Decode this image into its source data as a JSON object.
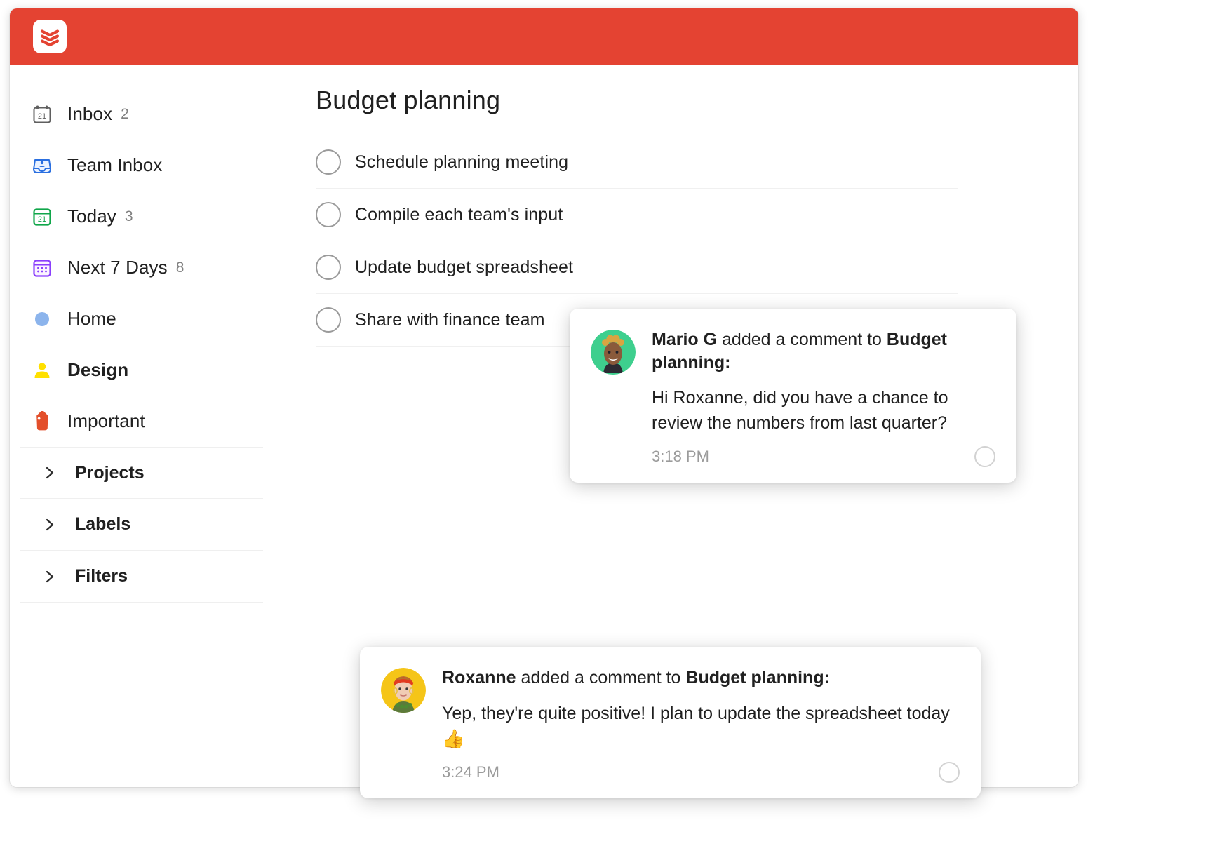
{
  "app": {
    "brand_color": "#e44332",
    "logo_icon": "todoist-logo-icon"
  },
  "sidebar": {
    "items": [
      {
        "label": "Inbox",
        "count": "2",
        "icon": "calendar-gray-icon",
        "bold": false
      },
      {
        "label": "Team Inbox",
        "count": "",
        "icon": "team-inbox-icon",
        "bold": false
      },
      {
        "label": "Today",
        "count": "3",
        "icon": "calendar-green-icon",
        "bold": false
      },
      {
        "label": "Next 7 Days",
        "count": "8",
        "icon": "calendar-purple-icon",
        "bold": false
      },
      {
        "label": "Home",
        "count": "",
        "icon": "blue-dot-icon",
        "bold": false
      },
      {
        "label": "Design",
        "count": "",
        "icon": "person-yellow-icon",
        "bold": true
      },
      {
        "label": "Important",
        "count": "",
        "icon": "tag-red-icon",
        "bold": false
      }
    ],
    "sections": [
      {
        "label": "Projects",
        "icon": "chevron-right-icon"
      },
      {
        "label": "Labels",
        "icon": "chevron-right-icon"
      },
      {
        "label": "Filters",
        "icon": "chevron-right-icon"
      }
    ]
  },
  "main": {
    "title": "Budget planning",
    "tasks": [
      {
        "text": "Schedule planning meeting"
      },
      {
        "text": "Compile each team's input"
      },
      {
        "text": "Update budget spreadsheet"
      },
      {
        "text": "Share with finance team"
      }
    ]
  },
  "notifications": [
    {
      "author": "Mario G",
      "action": " added a comment to ",
      "target": "Budget planning:",
      "message": "Hi Roxanne, did you have a chance to review the numbers from last quarter?",
      "time": "3:18 PM",
      "avatar_bg": "#3ecf8e",
      "avatar_icon": "mario-avatar"
    },
    {
      "author": "Roxanne",
      "action": " added a comment to ",
      "target": "Budget planning:",
      "message": "Yep, they're quite positive! I plan to update the spreadsheet today ",
      "emoji": "👍",
      "time": "3:24 PM",
      "avatar_bg": "#f5c518",
      "avatar_icon": "roxanne-avatar"
    }
  ]
}
